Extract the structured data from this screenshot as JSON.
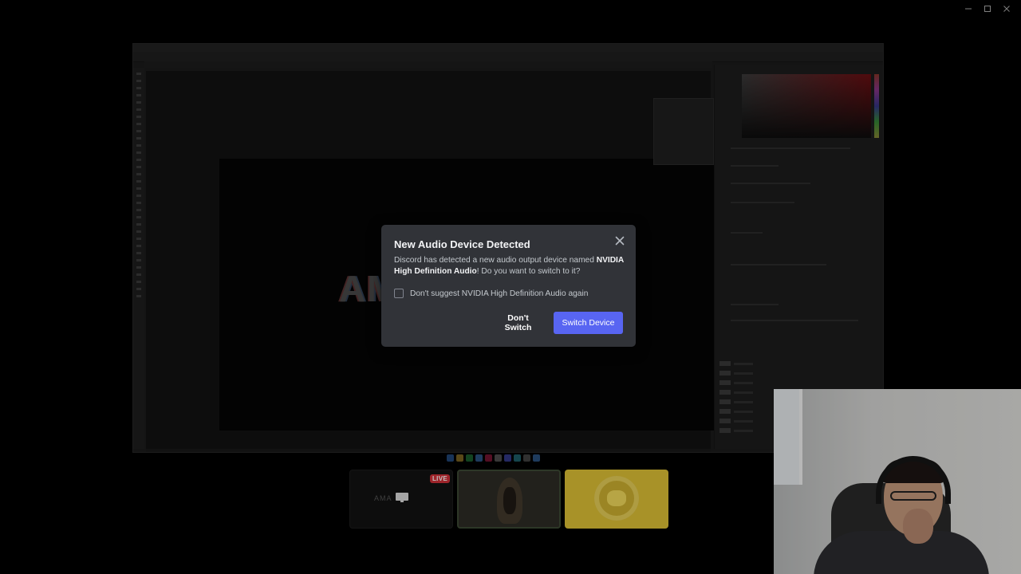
{
  "window_controls": {
    "minimize_icon": "minimize-icon",
    "maximize_icon": "maximize-icon",
    "close_icon": "close-icon"
  },
  "stream": {
    "canvas_text": "AM"
  },
  "tiles": [
    {
      "live_badge": "LIVE",
      "thumbnail_text": "AMA"
    },
    {
      "thumbnail": "figure"
    },
    {
      "thumbnail": "pikachu"
    }
  ],
  "modal": {
    "title": "New Audio Device Detected",
    "body_prefix": "Discord has detected a new audio output device named ",
    "device_name": "NVIDIA High Definition Audio",
    "body_suffix": "! Do you want to switch to it?",
    "checkbox_label": "Don't suggest NVIDIA High Definition Audio again",
    "checkbox_checked": false,
    "secondary_button": "Don't Switch",
    "primary_button": "Switch Device",
    "close_icon": "close-icon"
  },
  "colors": {
    "accent": "#5865f2",
    "modal_bg": "#313338",
    "live": "#d23038"
  }
}
